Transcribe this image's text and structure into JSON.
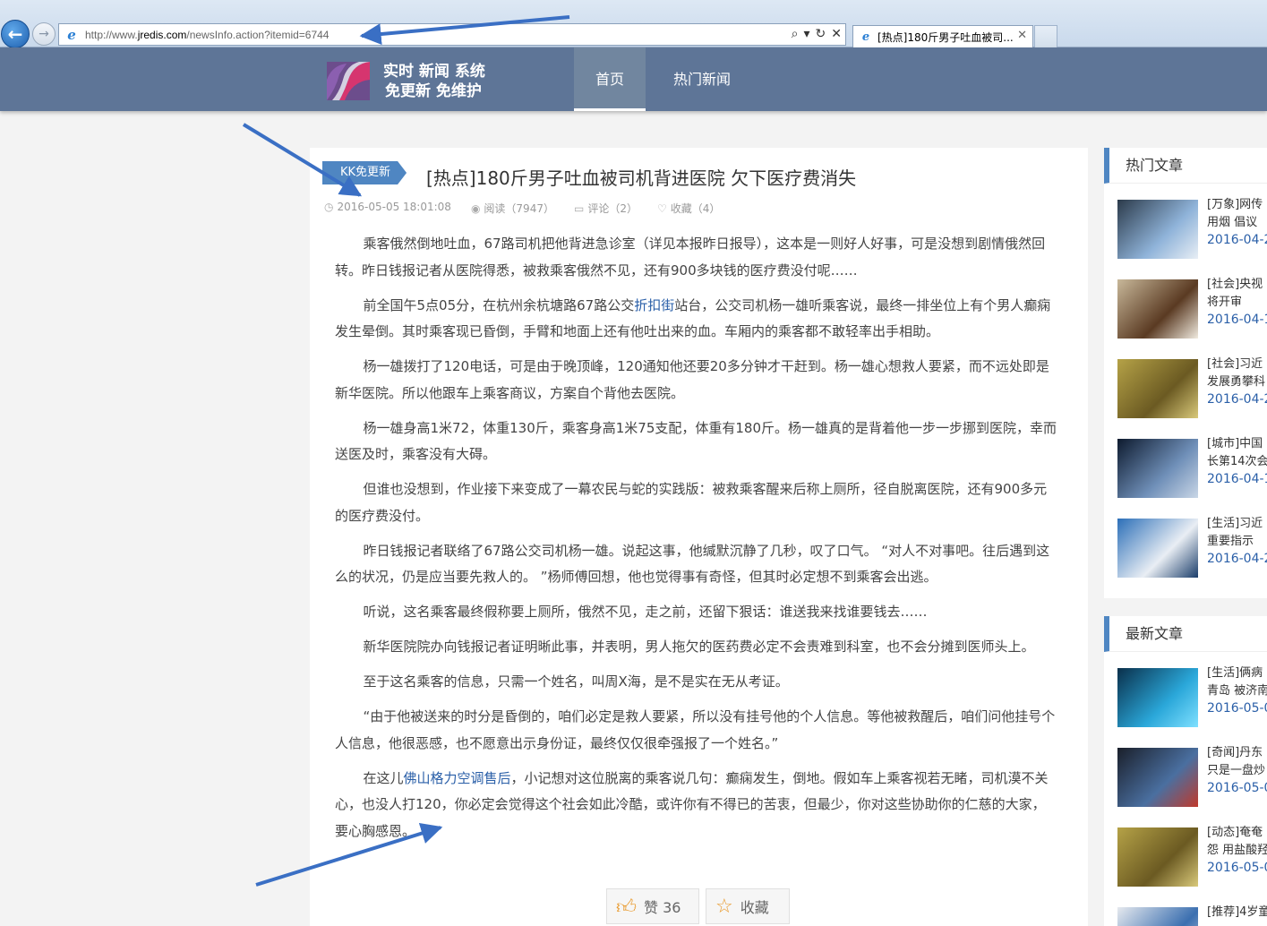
{
  "browser": {
    "url_prefix": "http://www.",
    "url_domain": "jredis.com",
    "url_path": "/newsInfo.action?itemid=6744",
    "tab_title": "[热点]180斤男子吐血被司...",
    "tools": {
      "search": "⌕",
      "dropdown": "▾",
      "refresh": "↻",
      "stop": "✕"
    }
  },
  "site": {
    "logo_line1": "实时 新闻 系统",
    "logo_line2": "免更新 免维护",
    "menu": {
      "home": "首页",
      "hot": "热门新闻"
    }
  },
  "article": {
    "badge": "KK免更新",
    "title": "[热点]180斤男子吐血被司机背进医院 欠下医疗费消失",
    "date": "2016-05-05 18:01:08",
    "reads": "阅读（7947）",
    "comments": "评论（2）",
    "favorites": "收藏（4）",
    "p1": "乘客俄然倒地吐血，67路司机把他背进急诊室（详见本报昨日报导），这本是一则好人好事，可是没想到剧情俄然回转。昨日钱报记者从医院得悉，被救乘客俄然不见，还有900多块钱的医疗费没付呢……",
    "p2_a": "前全国午5点05分，在杭州余杭塘路67路公交",
    "p2_link": "折扣街",
    "p2_b": "站台，公交司机杨一雄听乘客说，最终一排坐位上有个男人癫痫发生晕倒。其时乘客现已昏倒，手臂和地面上还有他吐出来的血。车厢内的乘客都不敢轻率出手相助。",
    "p3": "杨一雄拨打了120电话，可是由于晚顶峰，120通知他还要20多分钟才干赶到。杨一雄心想救人要紧，而不远处即是新华医院。所以他跟车上乘客商议，方案自个背他去医院。",
    "p4": "杨一雄身高1米72，体重130斤，乘客身高1米75支配，体重有180斤。杨一雄真的是背着他一步一步挪到医院，幸而送医及时，乘客没有大碍。",
    "p5": "但谁也没想到，作业接下来变成了一幕农民与蛇的实践版：被救乘客醒来后称上厕所，径自脱离医院，还有900多元的医疗费没付。",
    "p6": "昨日钱报记者联络了67路公交司机杨一雄。说起这事，他缄默沉静了几秒，叹了口气。 “对人不对事吧。往后遇到这么的状况，仍是应当要先救人的。 ”杨师傅回想，他也觉得事有奇怪，但其时必定想不到乘客会出逃。",
    "p7": "听说，这名乘客最终假称要上厕所，俄然不见，走之前，还留下狠话：谁送我来找谁要钱去……",
    "p8": "新华医院院办向钱报记者证明晰此事，并表明，男人拖欠的医药费必定不会责难到科室，也不会分摊到医师头上。",
    "p9": "至于这名乘客的信息，只需一个姓名，叫周X海，是不是实在无从考证。",
    "p10": " “由于他被送来的时分是昏倒的，咱们必定是救人要紧，所以没有挂号他的个人信息。等他被救醒后，咱们问他挂号个人信息，他很恶感，也不愿意出示身份证，最终仅仅很牵强报了一个姓名。”",
    "p11_a": "在这儿",
    "p11_link": "佛山格力空调售后",
    "p11_b": "，小记想对这位脱离的乘客说几句：癫痫发生，倒地。假如车上乘客视若无睹，司机漠不关心，也没人打120，你必定会觉得这个社会如此冷酷，或许你有不得已的苦衷，但最少，你对这些协助你的仁慈的大家，要心胸感恩。",
    "like_label": "赞 36",
    "fav_label": "收藏"
  },
  "sidebar": {
    "hot_title": "热门文章",
    "hot": [
      {
        "line1": "[万象]网传",
        "line2": "用烟 倡议",
        "date": "2016-04-2"
      },
      {
        "line1": "[社会]央视",
        "line2": "将开审",
        "date": "2016-04-1"
      },
      {
        "line1": "[社会]习近",
        "line2": "发展勇攀科",
        "date": "2016-04-2"
      },
      {
        "line1": "[城市]中国",
        "line2": "长第14次会",
        "date": "2016-04-1"
      },
      {
        "line1": "[生活]习近",
        "line2": "重要指示",
        "date": "2016-04-2"
      }
    ],
    "new_title": "最新文章",
    "latest": [
      {
        "line1": "[生活]俩病",
        "line2": "青岛 被济南",
        "date": "2016-05-0"
      },
      {
        "line1": "[奇闻]丹东",
        "line2": "只是一盘炒",
        "date": "2016-05-0"
      },
      {
        "line1": "[动态]奄奄",
        "line2": "怨 用盐酸羟",
        "date": "2016-05-0"
      },
      {
        "line1": "[推荐]4岁童",
        "line2": "",
        "date": ""
      }
    ]
  },
  "colors": {
    "header": "#5e7597",
    "accent": "#4f86c2",
    "link": "#2a5fa8",
    "arrow": "#3a6fc4"
  }
}
